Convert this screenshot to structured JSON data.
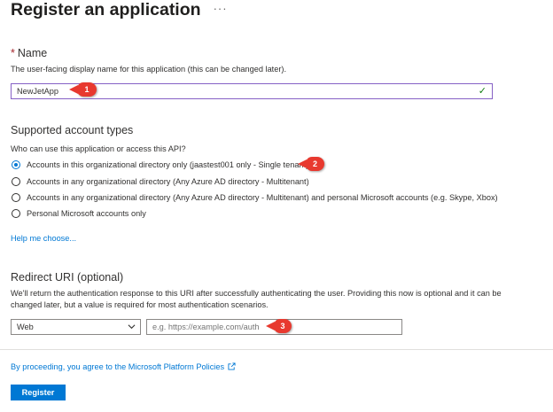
{
  "page": {
    "title": "Register an application",
    "more": "···"
  },
  "name": {
    "required_mark": "*",
    "heading": "Name",
    "description": "The user-facing display name for this application (this can be changed later).",
    "value": "NewJetApp",
    "callout": "1"
  },
  "account_types": {
    "heading": "Supported account types",
    "question": "Who can use this application or access this API?",
    "options": [
      {
        "label": "Accounts in this organizational directory only (jaastest001 only - Single tenant)",
        "checked": true
      },
      {
        "label": "Accounts in any organizational directory (Any Azure AD directory - Multitenant)",
        "checked": false
      },
      {
        "label": "Accounts in any organizational directory (Any Azure AD directory - Multitenant) and personal Microsoft accounts (e.g. Skype, Xbox)",
        "checked": false
      },
      {
        "label": "Personal Microsoft accounts only",
        "checked": false
      }
    ],
    "callout": "2",
    "help_link": "Help me choose..."
  },
  "redirect": {
    "heading": "Redirect URI (optional)",
    "description_line1": "We'll return the authentication response to this URI after successfully authenticating the user. Providing this now is optional and it can be",
    "description_line2": "changed later, but a value is required for most authentication scenarios.",
    "platform": "Web",
    "uri_placeholder": "e.g. https://example.com/auth",
    "callout": "3"
  },
  "footer": {
    "policy_link": "By proceeding, you agree to the Microsoft Platform Policies",
    "register_label": "Register"
  },
  "colors": {
    "accent": "#0078d4",
    "callout": "#e8392f",
    "valid": "#107c10"
  }
}
